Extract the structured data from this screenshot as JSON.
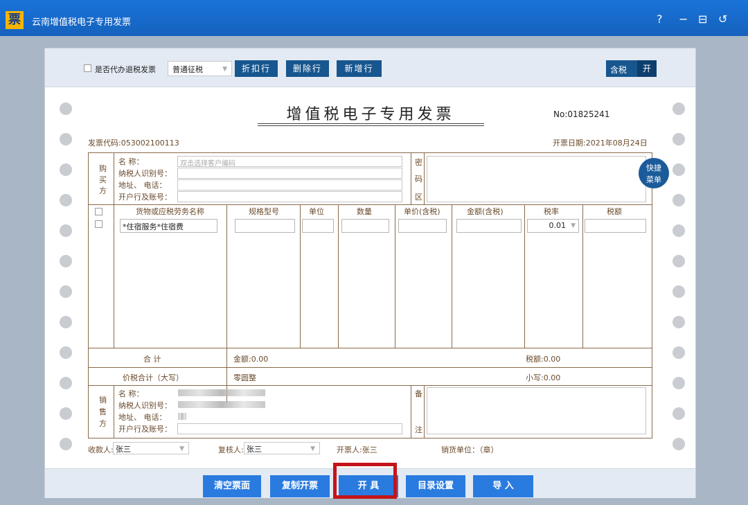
{
  "window": {
    "logo_char": "票",
    "title": "云南增值税电子专用发票",
    "controls": {
      "help": "?",
      "minimize": "−",
      "restore": "⊟",
      "back": "↺"
    }
  },
  "toolbar": {
    "agent_refund_label": "是否代办退税发票",
    "levy_type": "普通征税",
    "discount_button": "折扣行",
    "delete_button": "删除行",
    "add_button": "新增行",
    "tax_incl_label": "含税",
    "tax_incl_state": "开"
  },
  "invoice": {
    "title": "增值税电子专用发票",
    "number": "No:01825241",
    "code": "发票代码:053002100113",
    "date": "开票日期:2021年08月24日"
  },
  "buyer": {
    "section": [
      "购",
      "买",
      "方"
    ],
    "name_label": "名          称：",
    "name_placeholder": "双击选择客户编码",
    "tax_id_label": "纳税人识别号：",
    "address_label": "地址、  电话：",
    "bank_label": "开户行及账号：",
    "cipher_section": [
      "密",
      "码",
      "区"
    ]
  },
  "items": {
    "headers": [
      "货物或应税劳务名称",
      "规格型号",
      "单位",
      "数量",
      "单价(含税)",
      "金额(含税)",
      "税率",
      "税额"
    ],
    "rows": [
      {
        "name": "*住宿服务*住宿费",
        "spec": "",
        "unit": "",
        "qty": "",
        "price": "",
        "amount": "",
        "rate": "0.01",
        "tax": ""
      }
    ]
  },
  "totals": {
    "sum_label": "合    计",
    "amount": "金额:0.00",
    "tax": "税额:0.00",
    "total_label": "价税合计（大写）",
    "total_upper": "零圆整",
    "total_lower": "小写:0.00"
  },
  "seller": {
    "section": [
      "销",
      "售",
      "方"
    ],
    "name_label": "名          称：",
    "tax_id_label": "纳税人识别号：",
    "address_label": "地址、  电话：",
    "bank_label": "开户行及账号：",
    "remark_section": [
      "备",
      "注"
    ]
  },
  "signers": {
    "payee_label": "收款人:",
    "payee": "张三",
    "reviewer_label": "复核人:",
    "reviewer": "张三",
    "issuer": "开票人:张三",
    "seller_unit": "销货单位：（章）"
  },
  "quick_menu": [
    "快捷",
    "菜单"
  ],
  "footer": {
    "clear": "清空票面",
    "copy": "复制开票",
    "issue": "开  具",
    "catalog": "目录设置",
    "import": "导  入"
  }
}
